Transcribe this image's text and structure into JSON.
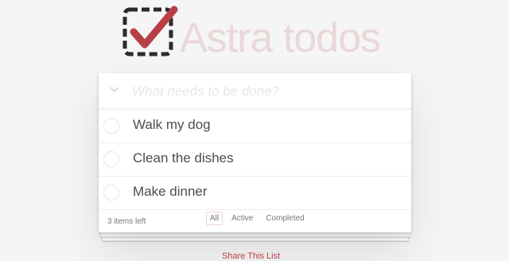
{
  "header": {
    "title": "Astra todos",
    "logo_icon": "checkbox-check-icon",
    "title_color": "#ead7d7",
    "accent_color": "#b83f45"
  },
  "new_todo": {
    "toggle_icon": "chevron-down-icon",
    "placeholder": "What needs to be done?",
    "value": ""
  },
  "todos": [
    {
      "label": "Walk my dog",
      "completed": false
    },
    {
      "label": "Clean the dishes",
      "completed": false
    },
    {
      "label": "Make dinner",
      "completed": false
    }
  ],
  "footer": {
    "items_left": "3 items left",
    "filters": [
      {
        "label": "All",
        "selected": true
      },
      {
        "label": "Active",
        "selected": false
      },
      {
        "label": "Completed",
        "selected": false
      }
    ]
  },
  "share_link": "Share This List"
}
